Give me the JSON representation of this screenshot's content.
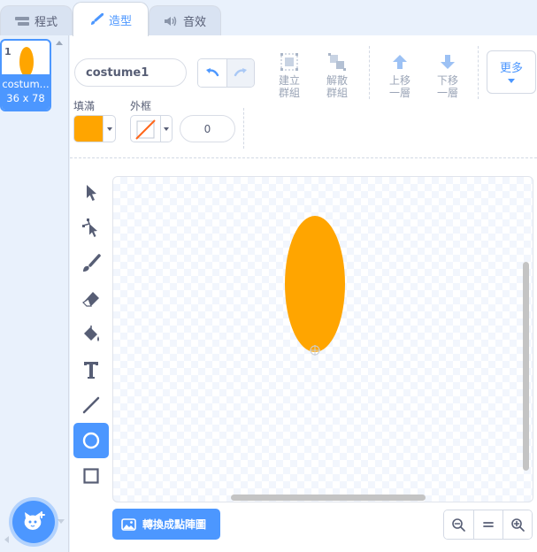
{
  "tabs": [
    {
      "label": "程式",
      "icon": "code-icon"
    },
    {
      "label": "造型",
      "icon": "brush-icon"
    },
    {
      "label": "音效",
      "icon": "speaker-icon"
    }
  ],
  "costumes": [
    {
      "number": "1",
      "name": "costum...",
      "size": "36 x 78",
      "fill": "#ffa500"
    }
  ],
  "editor": {
    "costume_name": "costume1",
    "toolbar": {
      "group": "建立群組",
      "ungroup": "解散群組",
      "forward": "上移一層",
      "backward": "下移一層",
      "more": "更多"
    },
    "fill_label": "填滿",
    "outline_label": "外框",
    "fill_color": "#ffa500",
    "stroke_width": "0",
    "active_tool": "ellipse",
    "convert_button": "轉換成點陣圖"
  },
  "colors": {
    "accent": "#4c97ff",
    "shape": "#ffa500"
  }
}
